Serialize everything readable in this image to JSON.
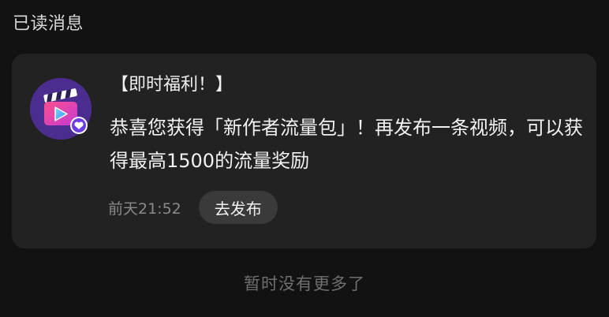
{
  "header": {
    "section_title": "已读消息"
  },
  "message": {
    "avatar_icon": "video-clapperboard-icon",
    "title": "【即时福利！】",
    "body": "恭喜您获得「新作者流量包」！再发布一条视频，可以获得最高1500的流量奖励",
    "timestamp": "前天21:52",
    "action_label": "去发布"
  },
  "footer": {
    "note": "暂时没有更多了"
  },
  "colors": {
    "background": "#121212",
    "card": "#222222",
    "button": "#3a3a3a",
    "avatar_bg": "#4a2d8f",
    "accent_pink": "#e4307a"
  }
}
